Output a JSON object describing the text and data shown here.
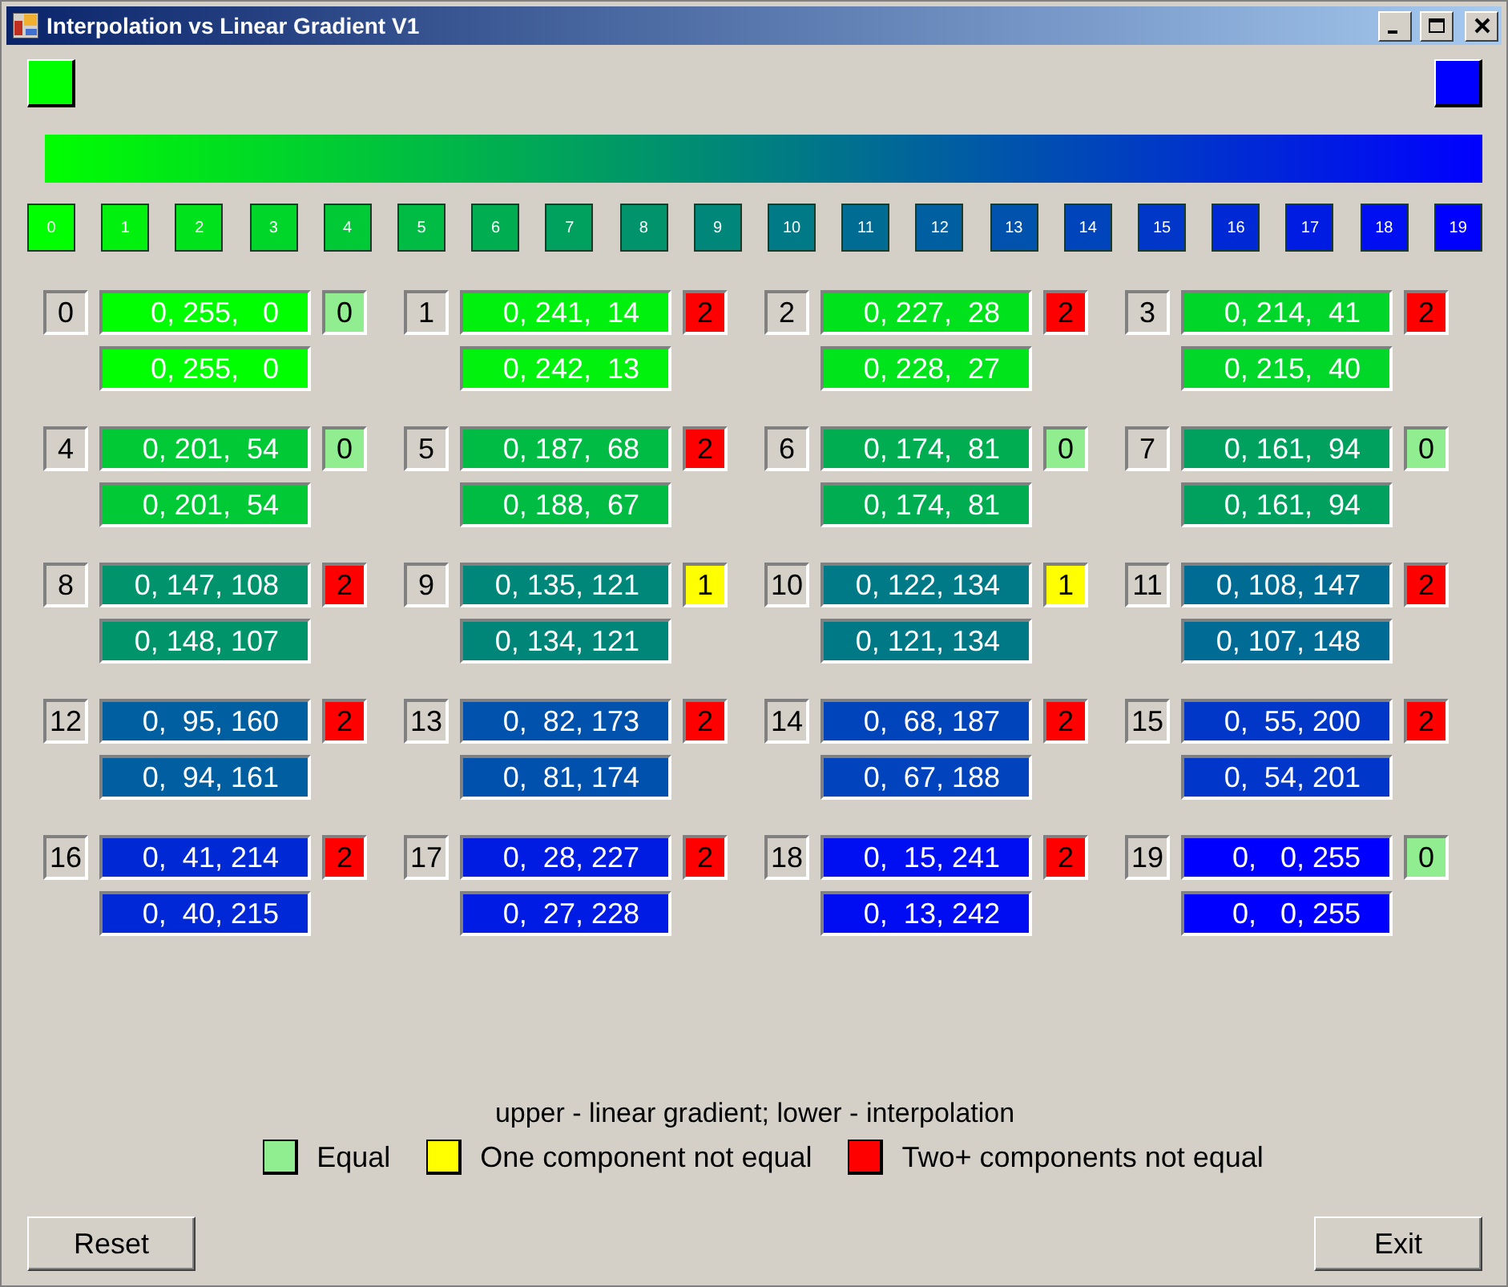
{
  "window": {
    "title": "Interpolation vs Linear Gradient V1"
  },
  "endpoints": [
    {
      "color": "#00ff00"
    },
    {
      "color": "#0000ff"
    }
  ],
  "swatches": [
    {
      "label": "0",
      "color": "#00ff00"
    },
    {
      "label": "1",
      "color": "#00f10e"
    },
    {
      "label": "2",
      "color": "#00e31c"
    },
    {
      "label": "3",
      "color": "#00d629"
    },
    {
      "label": "4",
      "color": "#00c936"
    },
    {
      "label": "5",
      "color": "#00bb44"
    },
    {
      "label": "6",
      "color": "#00ae51"
    },
    {
      "label": "7",
      "color": "#00a15e"
    },
    {
      "label": "8",
      "color": "#00936c"
    },
    {
      "label": "9",
      "color": "#008779"
    },
    {
      "label": "10",
      "color": "#007a86"
    },
    {
      "label": "11",
      "color": "#006c93"
    },
    {
      "label": "12",
      "color": "#005fa0"
    },
    {
      "label": "13",
      "color": "#0052ad"
    },
    {
      "label": "14",
      "color": "#0044bb"
    },
    {
      "label": "15",
      "color": "#0037c8"
    },
    {
      "label": "16",
      "color": "#0029d6"
    },
    {
      "label": "17",
      "color": "#001ce3"
    },
    {
      "label": "18",
      "color": "#000ff1"
    },
    {
      "label": "19",
      "color": "#0000ff"
    }
  ],
  "comparisons": [
    {
      "index": "0",
      "upper": {
        "text": "0, 255,   0",
        "color": "#00ff00"
      },
      "lower": {
        "text": "0, 255,   0",
        "color": "#00ff00"
      },
      "diff": {
        "text": "0",
        "color": "#90ee90"
      }
    },
    {
      "index": "1",
      "upper": {
        "text": "0, 241,  14",
        "color": "#00f10e"
      },
      "lower": {
        "text": "0, 242,  13",
        "color": "#00f20d"
      },
      "diff": {
        "text": "2",
        "color": "#ff0000"
      }
    },
    {
      "index": "2",
      "upper": {
        "text": "0, 227,  28",
        "color": "#00e31c"
      },
      "lower": {
        "text": "0, 228,  27",
        "color": "#00e41b"
      },
      "diff": {
        "text": "2",
        "color": "#ff0000"
      }
    },
    {
      "index": "3",
      "upper": {
        "text": "0, 214,  41",
        "color": "#00d629"
      },
      "lower": {
        "text": "0, 215,  40",
        "color": "#00d728"
      },
      "diff": {
        "text": "2",
        "color": "#ff0000"
      }
    },
    {
      "index": "4",
      "upper": {
        "text": "0, 201,  54",
        "color": "#00c936"
      },
      "lower": {
        "text": "0, 201,  54",
        "color": "#00c936"
      },
      "diff": {
        "text": "0",
        "color": "#90ee90"
      }
    },
    {
      "index": "5",
      "upper": {
        "text": "0, 187,  68",
        "color": "#00bb44"
      },
      "lower": {
        "text": "0, 188,  67",
        "color": "#00bc43"
      },
      "diff": {
        "text": "2",
        "color": "#ff0000"
      }
    },
    {
      "index": "6",
      "upper": {
        "text": "0, 174,  81",
        "color": "#00ae51"
      },
      "lower": {
        "text": "0, 174,  81",
        "color": "#00ae51"
      },
      "diff": {
        "text": "0",
        "color": "#90ee90"
      }
    },
    {
      "index": "7",
      "upper": {
        "text": "0, 161,  94",
        "color": "#00a15e"
      },
      "lower": {
        "text": "0, 161,  94",
        "color": "#00a15e"
      },
      "diff": {
        "text": "0",
        "color": "#90ee90"
      }
    },
    {
      "index": "8",
      "upper": {
        "text": "0, 147, 108",
        "color": "#00936c"
      },
      "lower": {
        "text": "0, 148, 107",
        "color": "#00946b"
      },
      "diff": {
        "text": "2",
        "color": "#ff0000"
      }
    },
    {
      "index": "9",
      "upper": {
        "text": "0, 135, 121",
        "color": "#008779"
      },
      "lower": {
        "text": "0, 134, 121",
        "color": "#008679"
      },
      "diff": {
        "text": "1",
        "color": "#ffff00"
      }
    },
    {
      "index": "10",
      "upper": {
        "text": "0, 122, 134",
        "color": "#007a86"
      },
      "lower": {
        "text": "0, 121, 134",
        "color": "#007986"
      },
      "diff": {
        "text": "1",
        "color": "#ffff00"
      }
    },
    {
      "index": "11",
      "upper": {
        "text": "0, 108, 147",
        "color": "#006c93"
      },
      "lower": {
        "text": "0, 107, 148",
        "color": "#006b94"
      },
      "diff": {
        "text": "2",
        "color": "#ff0000"
      }
    },
    {
      "index": "12",
      "upper": {
        "text": "0,  95, 160",
        "color": "#005fa0"
      },
      "lower": {
        "text": "0,  94, 161",
        "color": "#005ea1"
      },
      "diff": {
        "text": "2",
        "color": "#ff0000"
      }
    },
    {
      "index": "13",
      "upper": {
        "text": "0,  82, 173",
        "color": "#0052ad"
      },
      "lower": {
        "text": "0,  81, 174",
        "color": "#0051ae"
      },
      "diff": {
        "text": "2",
        "color": "#ff0000"
      }
    },
    {
      "index": "14",
      "upper": {
        "text": "0,  68, 187",
        "color": "#0044bb"
      },
      "lower": {
        "text": "0,  67, 188",
        "color": "#0043bc"
      },
      "diff": {
        "text": "2",
        "color": "#ff0000"
      }
    },
    {
      "index": "15",
      "upper": {
        "text": "0,  55, 200",
        "color": "#0037c8"
      },
      "lower": {
        "text": "0,  54, 201",
        "color": "#0036c9"
      },
      "diff": {
        "text": "2",
        "color": "#ff0000"
      }
    },
    {
      "index": "16",
      "upper": {
        "text": "0,  41, 214",
        "color": "#0029d6"
      },
      "lower": {
        "text": "0,  40, 215",
        "color": "#0028d7"
      },
      "diff": {
        "text": "2",
        "color": "#ff0000"
      }
    },
    {
      "index": "17",
      "upper": {
        "text": "0,  28, 227",
        "color": "#001ce3"
      },
      "lower": {
        "text": "0,  27, 228",
        "color": "#001be4"
      },
      "diff": {
        "text": "2",
        "color": "#ff0000"
      }
    },
    {
      "index": "18",
      "upper": {
        "text": "0,  15, 241",
        "color": "#000ff1"
      },
      "lower": {
        "text": "0,  13, 242",
        "color": "#000df2"
      },
      "diff": {
        "text": "2",
        "color": "#ff0000"
      }
    },
    {
      "index": "19",
      "upper": {
        "text": "0,   0, 255",
        "color": "#0000ff"
      },
      "lower": {
        "text": "0,   0, 255",
        "color": "#0000ff"
      },
      "diff": {
        "text": "0",
        "color": "#90ee90"
      }
    }
  ],
  "legend": {
    "caption": "upper - linear gradient; lower - interpolation",
    "items": [
      {
        "label": "Equal",
        "color": "#90ee90"
      },
      {
        "label": "One component not equal",
        "color": "#ffff00"
      },
      {
        "label": "Two+ components not equal",
        "color": "#ff0000"
      }
    ]
  },
  "buttons": [
    {
      "label": "Reset"
    },
    {
      "label": "Exit"
    }
  ]
}
